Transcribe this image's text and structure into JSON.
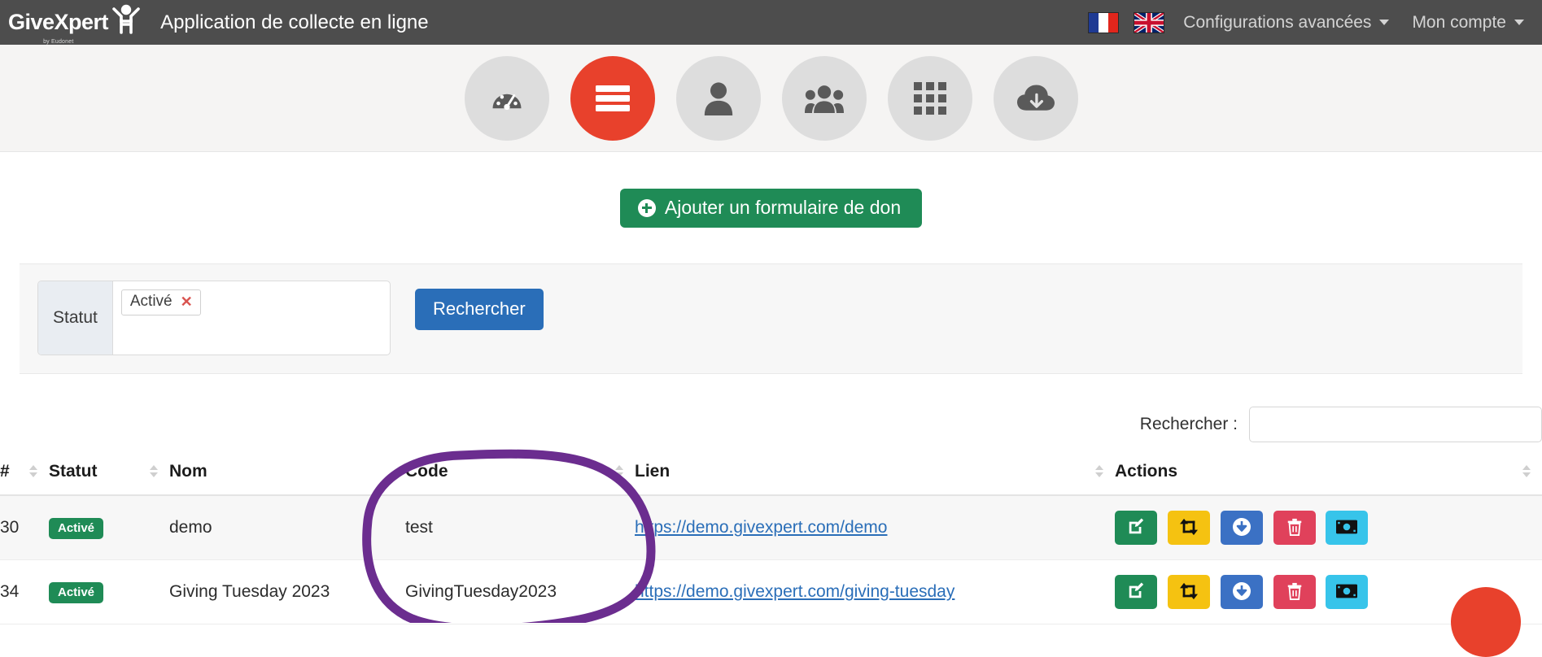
{
  "topbar": {
    "brand_name": "GiveXpert",
    "brand_sub": "by Eudonet",
    "brand_icon": "person-raised-arms-icon",
    "app_title": "Application de collecte en ligne",
    "flags": [
      {
        "name": "flag-fr",
        "label": "Français"
      },
      {
        "name": "flag-en",
        "label": "English"
      }
    ],
    "menus": [
      {
        "label": "Configurations avancées",
        "caret": true
      },
      {
        "label": "Mon compte",
        "caret": true
      }
    ]
  },
  "iconnav": {
    "items": [
      {
        "icon": "dashboard-gauge-icon",
        "active": false
      },
      {
        "icon": "hamburger-menu-icon",
        "active": true
      },
      {
        "icon": "user-icon",
        "active": false
      },
      {
        "icon": "users-group-icon",
        "active": false
      },
      {
        "icon": "grid-apps-icon",
        "active": false
      },
      {
        "icon": "cloud-download-icon",
        "active": false
      }
    ],
    "active_color": "#e8412c",
    "inactive_color": "#dddddd"
  },
  "main": {
    "add_button": {
      "label": "Ajouter un formulaire de don",
      "icon": "plus-circle-icon",
      "color": "#1f8b56"
    }
  },
  "filter": {
    "status_label": "Statut",
    "tokens": [
      {
        "label": "Activé",
        "remove_icon": "x-icon"
      }
    ],
    "search_button": {
      "label": "Rechercher",
      "color": "#2a6eb8"
    }
  },
  "table_search": {
    "label": "Rechercher :",
    "value": "",
    "placeholder": ""
  },
  "table": {
    "columns": [
      {
        "key": "num",
        "label": "#",
        "sortable": true
      },
      {
        "key": "stat",
        "label": "Statut",
        "sortable": true
      },
      {
        "key": "nom",
        "label": "Nom",
        "sortable": false
      },
      {
        "key": "code",
        "label": "Code",
        "sortable": true
      },
      {
        "key": "lien",
        "label": "Lien",
        "sortable": true
      },
      {
        "key": "act",
        "label": "Actions",
        "sortable": true
      }
    ],
    "rows": [
      {
        "num": "30",
        "statut": "Activé",
        "nom": "demo",
        "code": "test",
        "lien": "https://demo.givexpert.com/demo"
      },
      {
        "num": "34",
        "statut": "Activé",
        "nom": "Giving Tuesday 2023",
        "code": "GivingTuesday2023",
        "lien": "https://demo.givexpert.com/giving-tuesday"
      }
    ],
    "row_actions": [
      {
        "name": "edit-button",
        "icon": "pen-square-icon",
        "color": "#1f8b56"
      },
      {
        "name": "duplicate-button",
        "icon": "retweet-icon",
        "color": "#f5c211"
      },
      {
        "name": "download-button",
        "icon": "arrow-down-circle-icon",
        "color": "#3b71c4"
      },
      {
        "name": "delete-button",
        "icon": "trash-icon",
        "color": "#e0415b"
      },
      {
        "name": "donations-button",
        "icon": "money-bill-icon",
        "color": "#37c4ea"
      }
    ],
    "status_badge_color": "#1f8b56",
    "link_color": "#2a6eb8"
  },
  "annotation": {
    "type": "hand-drawn-ellipse",
    "color": "#6b2d8f",
    "targets": "Code column (header + test + GivingTuesday2023)"
  },
  "fab": {
    "name": "help-chat-bubble",
    "color": "#e8412c"
  }
}
